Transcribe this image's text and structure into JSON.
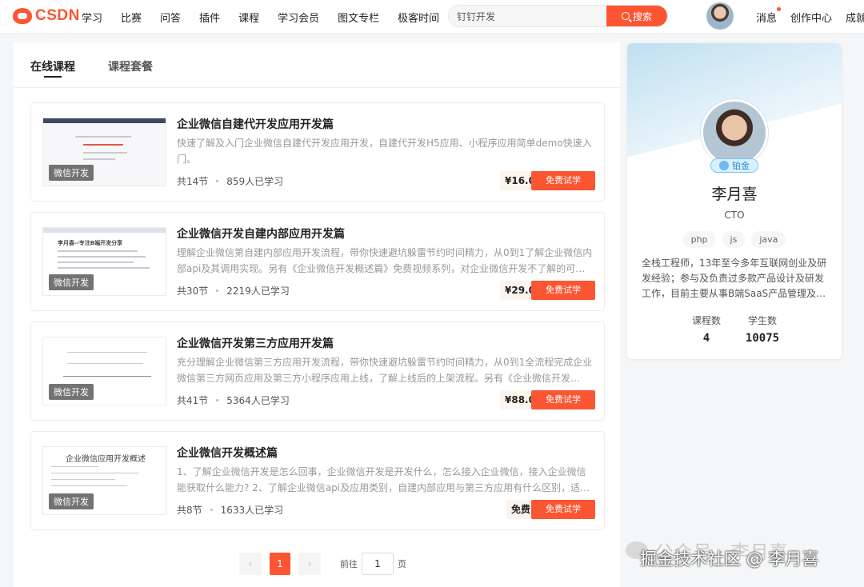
{
  "header": {
    "logo_text": "CSDN",
    "nav": [
      "学习",
      "比赛",
      "问答",
      "插件",
      "课程",
      "学习会员",
      "图文专栏",
      "极客时间"
    ],
    "search": {
      "value": "钉钉开发",
      "button": "搜索"
    },
    "right_links": {
      "messages": "消息",
      "creator": "创作中心",
      "achievements": "成就"
    }
  },
  "tabs": {
    "online": "在线课程",
    "bundles": "课程套餐"
  },
  "courses": [
    {
      "title": "企业微信自建代开发应用开发篇",
      "desc": "快速了解及入门企业微信自建代开发应用开发，自建代开发H5应用、小程序应用简单demo快速入门。",
      "lessons": "共14节",
      "learners": "859人已学习",
      "price": "¥16.0",
      "tag": "微信开发",
      "button": "免费试学"
    },
    {
      "title": "企业微信开发自建内部应用开发篇",
      "desc": "理解企业微信第自建内部应用开发流程，带你快速避坑躲雷节约时间精力，从0到1了解企业微信内部api及其调用实现。另有《企业微信开发概述篇》免费视频系列，对企业微信开发不了解的可…",
      "lessons": "共30节",
      "learners": "2219人已学习",
      "price": "¥29.0",
      "tag": "微信开发",
      "button": "免费试学",
      "thumb_title": "李月喜--专注B端开发分享"
    },
    {
      "title": "企业微信开发第三方应用开发篇",
      "desc": "充分理解企业微信第三方应用开发流程，带你快速避坑躲雷节约时间精力，从0到1全流程完成企业微信第三方网页应用及第三方小程序应用上线，了解上线后的上架流程。另有《企业微信开发…",
      "lessons": "共41节",
      "learners": "5364人已学习",
      "price": "¥88.0",
      "tag": "微信开发",
      "button": "免费试学"
    },
    {
      "title": "企业微信开发概述篇",
      "desc": "1、了解企业微信开发是怎么回事，企业微信开发是开发什么，怎么接入企业微信，接入企业微信能获取什么能力? 2、了解企业微信api及应用类别，自建内部应用与第三方应用有什么区别，适…",
      "lessons": "共8节",
      "learners": "1633人已学习",
      "price": "免费",
      "tag": "微信开发",
      "button": "免费试学",
      "thumb_title": "企业微信应用开发概述"
    }
  ],
  "pagination": {
    "prev": "‹",
    "current": "1",
    "next": "›",
    "goto_label": "前往",
    "goto_value": "1",
    "page_label": "页"
  },
  "profile": {
    "name": "李月喜",
    "role": "CTO",
    "badge": "铂金",
    "tags": [
      "php",
      "js",
      "java"
    ],
    "bio": "全栈工程师，13年至今多年互联网创业及研发经验；参与及负责过多款产品设计及研发工作，目前主要从事B端SaaS产品管理及…",
    "stats": [
      {
        "label": "课程数",
        "value": "4"
      },
      {
        "label": "学生数",
        "value": "10075"
      }
    ]
  },
  "watermark": {
    "line1": "公众号 · 李月喜",
    "line2": "掘金技术社区 @ 李月喜"
  },
  "colors": {
    "accent": "#fc5531",
    "badge": "#7cc3f0"
  }
}
